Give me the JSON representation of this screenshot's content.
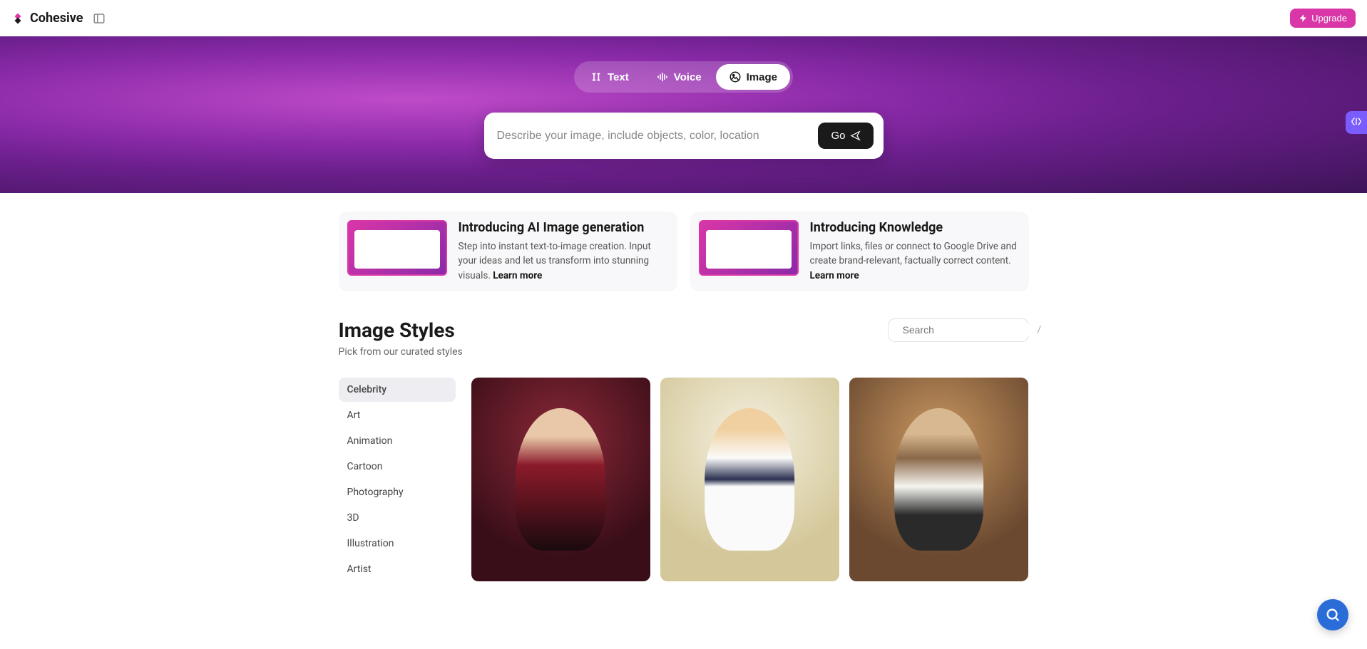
{
  "header": {
    "brand": "Cohesive",
    "upgrade_label": "Upgrade"
  },
  "hero": {
    "tabs": {
      "text": "Text",
      "voice": "Voice",
      "image": "Image"
    },
    "prompt_placeholder": "Describe your image, include objects, color, location",
    "go_label": "Go"
  },
  "promo": {
    "card1": {
      "title": "Introducing AI Image generation",
      "desc": "Step into instant text-to-image creation. Input your ideas and let us transform into stunning visuals. ",
      "learn": "Learn more"
    },
    "card2": {
      "title": "Introducing Knowledge",
      "desc": "Import links, files or connect to Google Drive and create brand-relevant, factually correct content. ",
      "learn": "Learn more"
    }
  },
  "styles": {
    "heading": "Image Styles",
    "sub": "Pick from our curated styles",
    "search_placeholder": "Search",
    "search_hint": "/",
    "categories": [
      "Celebrity",
      "Art",
      "Animation",
      "Cartoon",
      "Photography",
      "3D",
      "Illustration",
      "Artist"
    ]
  }
}
